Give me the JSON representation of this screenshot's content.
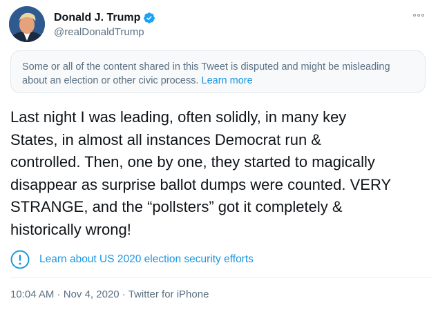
{
  "author": {
    "display_name": "Donald J. Trump",
    "handle": "@realDonaldTrump",
    "verified": true
  },
  "notice": {
    "text": "Some or all of the content shared in this Tweet is disputed and might be misleading about an election or other civic process.",
    "link_label": "Learn more"
  },
  "tweet": {
    "text": "Last night I was leading, often solidly, in many key\nStates, in almost all instances Democrat run &\ncontrolled. Then, one by one, they started to magically\ndisappear as surprise ballot dumps were counted. VERY\nSTRANGE, and the “pollsters” got it completely &\nhistorically wrong!"
  },
  "civic": {
    "link_label": "Learn about US 2020 election security efforts"
  },
  "meta": {
    "time": "10:04 AM",
    "separator": " · ",
    "date": "Nov 4, 2020",
    "source": "Twitter for iPhone"
  },
  "colors": {
    "link": "#1b95e0",
    "secondary_text": "#5b7083",
    "notice_bg": "#f7f9fa",
    "verified_badge": "#1da1f2"
  },
  "icons": {
    "verified": "verified-badge-icon",
    "more": "more-options-icon",
    "info": "info-exclamation-icon"
  }
}
